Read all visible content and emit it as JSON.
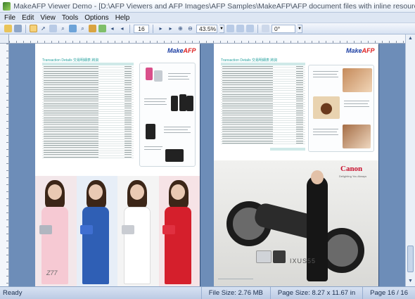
{
  "window": {
    "title": "MakeAFP Viewer Demo - [D:\\AFP Viewers and AFP Images\\AFP Samples\\MakeAFP\\AFP document files with inline resources\\jbs..."
  },
  "menu": [
    "File",
    "Edit",
    "View",
    "Tools",
    "Options",
    "Help"
  ],
  "toolbar": {
    "page_number": "16",
    "zoom": "43.5%",
    "rotation": "0°"
  },
  "page_left": {
    "logo_main": "Make",
    "logo_accent": "AFP",
    "section_title": "Transaction Details 交易明細表 將資",
    "camera_label": "Z77"
  },
  "page_right": {
    "logo_main": "Make",
    "logo_accent": "AFP",
    "section_title": "Transaction Details 交易明細表 將資",
    "brand": "Canon",
    "brand_tagline": "Delighting You Always",
    "product": "IXUS55"
  },
  "status": {
    "ready": "Ready",
    "file_size": "File Size: 2.76 MB",
    "page_size": "Page Size: 8.27 x 11.67 in",
    "page_count": "Page 16 / 16"
  },
  "colors": {
    "canvas": "#6d8db8",
    "chrome": "#dde6f3",
    "accent_teal": "#2aa3a0"
  }
}
